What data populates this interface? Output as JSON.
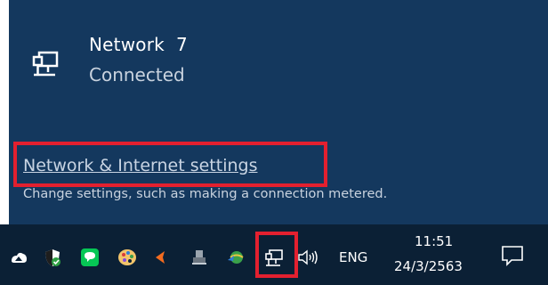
{
  "network_flyout": {
    "network_name": "Network  7",
    "connection_status": "Connected",
    "settings_link": "Network & Internet settings",
    "settings_description": "Change settings, such as making a connection metered."
  },
  "taskbar": {
    "tray_icons": [
      "show-hidden-icons-up-arrow-icon",
      "security-shield-icon",
      "line-chat-icon",
      "color-palette-icon",
      "media-player-icon",
      "usb-drive-icon",
      "network-globe-app-icon",
      "network-ethernet-icon",
      "volume-speaker-icon",
      "notification-center-icon"
    ],
    "language": "ENG",
    "clock_time": "11:51",
    "clock_date": "24/3/2563"
  },
  "colors": {
    "flyout_background": "#14385e",
    "taskbar_background": "#0b2035",
    "highlight": "#e3202f"
  }
}
